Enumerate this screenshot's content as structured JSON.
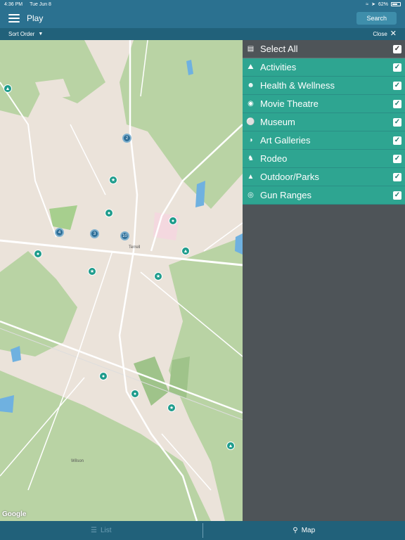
{
  "status": {
    "time": "4:36 PM",
    "date": "Tue Jun 8",
    "battery": "62%"
  },
  "nav": {
    "title": "Play",
    "search_label": "Search"
  },
  "sort": {
    "label": "Sort Order",
    "close_label": "Close"
  },
  "map": {
    "town_labels": [
      "Terrell",
      "Wilson"
    ],
    "attribution": "Google",
    "clusters": [
      "2",
      "4",
      "3",
      "10"
    ]
  },
  "panel": {
    "select_all": {
      "label": "Select All",
      "icon": "list-icon",
      "checked": true
    },
    "categories": [
      {
        "label": "Activities",
        "icon": "theater-icon",
        "checked": true
      },
      {
        "label": "Health & Wellness",
        "icon": "wellness-icon",
        "checked": true
      },
      {
        "label": "Movie Theatre",
        "icon": "film-camera-icon",
        "checked": true
      },
      {
        "label": "Museum",
        "icon": "museum-icon",
        "checked": true
      },
      {
        "label": "Art Galleries",
        "icon": "palette-icon",
        "checked": true
      },
      {
        "label": "Rodeo",
        "icon": "horse-icon",
        "checked": true
      },
      {
        "label": "Outdoor/Parks",
        "icon": "tree-icon",
        "checked": true
      },
      {
        "label": "Gun Ranges",
        "icon": "target-icon",
        "checked": true
      }
    ]
  },
  "tabs": {
    "list_label": "List",
    "map_label": "Map"
  },
  "colors": {
    "header": "#2b7190",
    "category_bg": "#2ea591",
    "panel_bg": "#4e5458"
  }
}
